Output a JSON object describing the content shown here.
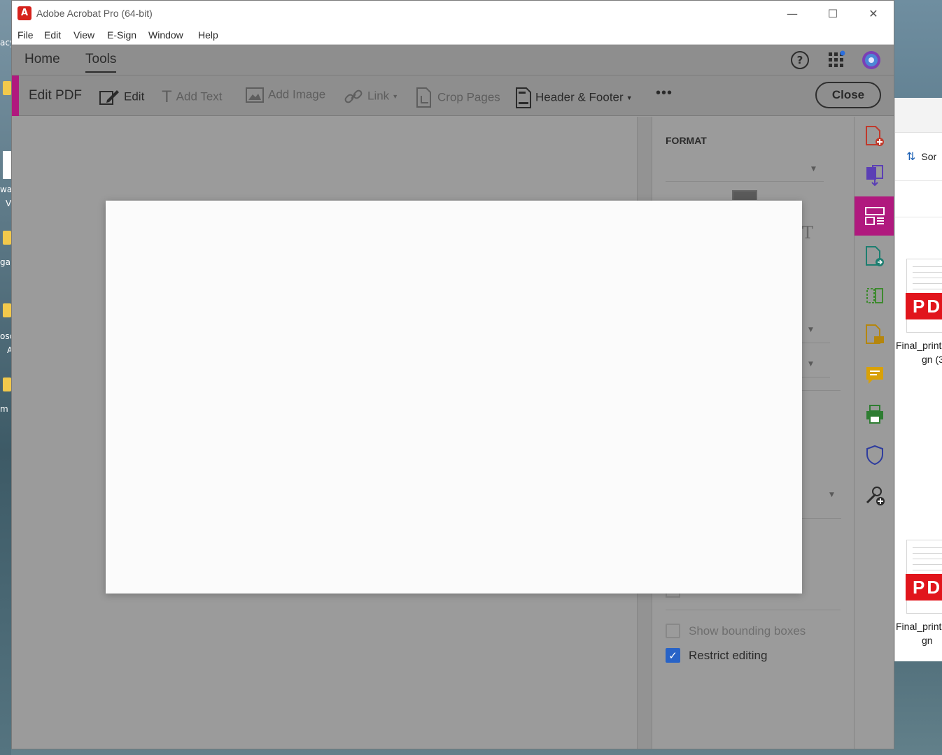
{
  "window": {
    "title": "Adobe Acrobat Pro (64-bit)",
    "min": "—",
    "max": "☐",
    "close": "✕"
  },
  "menu": [
    "File",
    "Edit",
    "View",
    "E-Sign",
    "Window",
    "Help"
  ],
  "nav": {
    "tabs": [
      "Home",
      "Tools"
    ],
    "active": "Tools"
  },
  "toolbar": {
    "title": "Edit PDF",
    "items": [
      "Edit",
      "Add Text",
      "Add Image",
      "Link",
      "Crop Pages",
      "Header & Footer"
    ],
    "more": "•••",
    "close_label": "Close"
  },
  "panel": {
    "heading": "FORMAT",
    "show_bounding_boxes": "Show bounding boxes",
    "restrict_editing": "Restrict editing",
    "restrict_checked": true,
    "bounding_checked": false
  },
  "explorer": {
    "sort_label": "Sor",
    "files": [
      {
        "badge": "PD",
        "name_line1": "Final_print",
        "name_line2": "gn (3"
      },
      {
        "badge": "PD",
        "name_line1": "Final_print",
        "name_line2": "gn"
      }
    ]
  },
  "desktop_fragments": [
    "acy",
    "wa",
    "V",
    "ga",
    "osc",
    "A",
    "m"
  ],
  "colors": {
    "accent": "#b0197e",
    "check": "#2863c7",
    "pdf_red": "#e1151c"
  }
}
